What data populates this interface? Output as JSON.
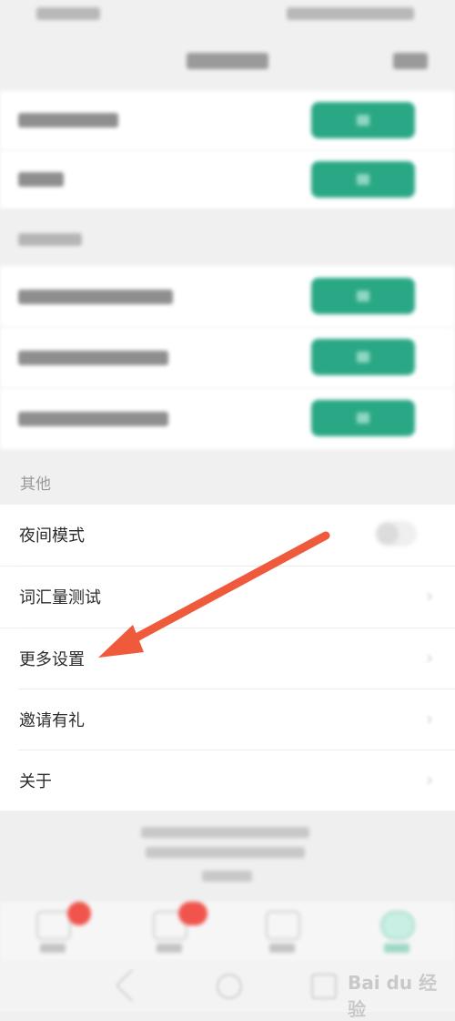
{
  "other_section": {
    "title": "其他",
    "items": [
      {
        "label": "夜间模式"
      },
      {
        "label": "词汇量测试"
      },
      {
        "label": "更多设置"
      },
      {
        "label": "邀请有礼"
      },
      {
        "label": "关于"
      }
    ]
  },
  "watermark": {
    "text": "Bai du 经验"
  },
  "colors": {
    "accent_green": "#2aa886",
    "annotation_arrow": "#ef5a3c",
    "badge_red": "#f0544c"
  }
}
